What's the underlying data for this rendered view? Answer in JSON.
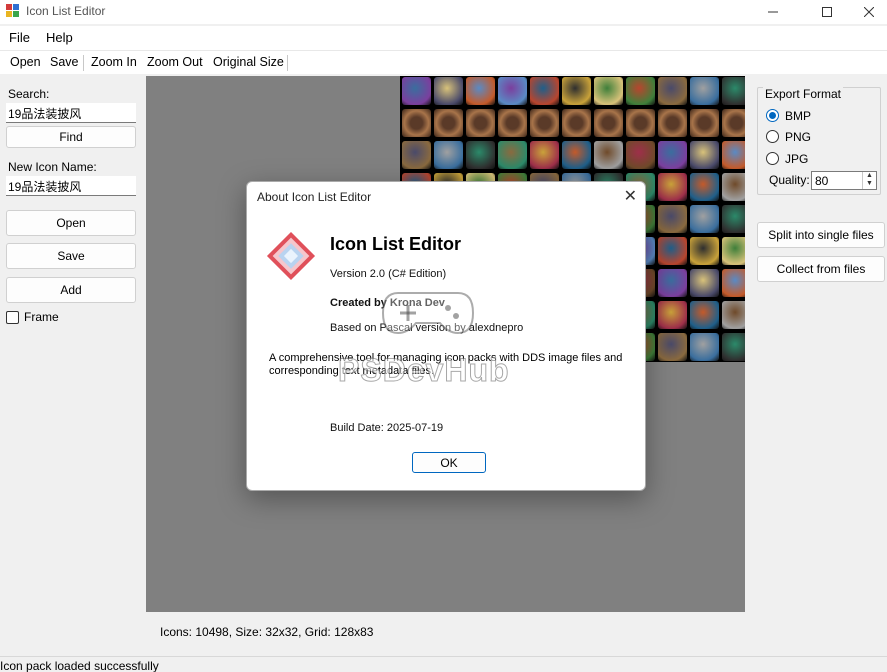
{
  "window": {
    "title": "Icon List Editor"
  },
  "menu": {
    "file": "File",
    "help": "Help"
  },
  "toolbar": {
    "open": "Open",
    "save": "Save",
    "zoom_in": "Zoom In",
    "zoom_out": "Zoom Out",
    "original_size": "Original Size"
  },
  "left_panel": {
    "search_label": "Search:",
    "search_value": "19品法装披风",
    "find_button": "Find",
    "new_icon_label": "New Icon Name:",
    "new_icon_value": "19品法装披风",
    "open_button": "Open",
    "save_button": "Save",
    "add_button": "Add",
    "frame_label": "Frame"
  },
  "right_panel": {
    "export_format_title": "Export Format",
    "formats": [
      "BMP",
      "PNG",
      "JPG"
    ],
    "selected_format": "BMP",
    "quality_label": "Quality:",
    "quality_value": "80",
    "split_button": "Split into single files",
    "collect_button": "Collect from files"
  },
  "info_line": "Icons: 10498, Size: 32x32, Grid: 128x83",
  "status": "Icon pack loaded successfully",
  "dialog": {
    "title": "About Icon List Editor",
    "heading": "Icon List Editor",
    "version": "Version 2.0 (C# Edition)",
    "created_by": "Created by Krona Dev",
    "based_on": "Based on Pascal version by alexdnepro",
    "description": "A comprehensive tool for managing icon packs with DDS image files and corresponding text metadata files.",
    "build_date": "Build Date: 2025-07-19",
    "ok_button": "OK"
  },
  "watermark": "PSDevHub",
  "colors": {
    "accent": "#0067c0",
    "canvas": "#808080",
    "logo_red": "#e0505a",
    "logo_blue": "#b9d3f0"
  }
}
